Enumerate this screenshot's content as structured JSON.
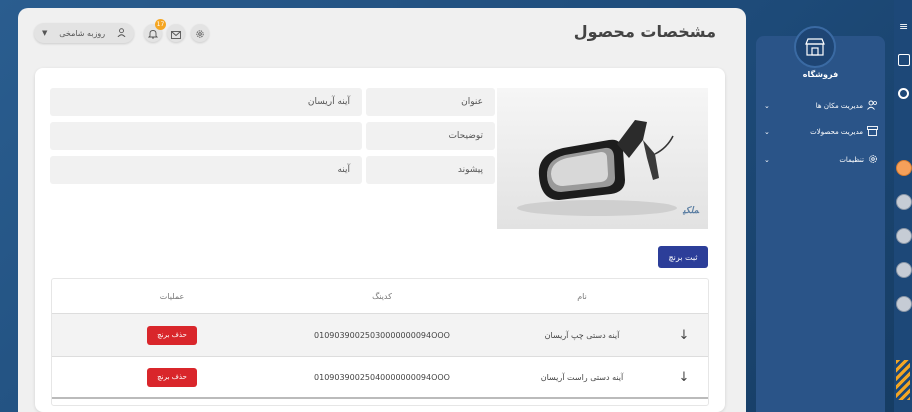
{
  "header": {
    "page_title": "مشخصات محصول",
    "user_name": "روزبه شامخی",
    "notification_count": "17"
  },
  "product": {
    "fields": [
      {
        "label": "عنوان",
        "value": "آینه آریسان"
      },
      {
        "label": "توضیحات",
        "value": ""
      },
      {
        "label": "پیشوند",
        "value": "آینه"
      }
    ],
    "photo_watermark": "ﻤﻠﻜﻴ"
  },
  "actions": {
    "add_brand_label": "ثبت برنچ"
  },
  "table": {
    "headers": {
      "name": "نام",
      "code": "کدینگ",
      "ops": "عملیات"
    },
    "rows": [
      {
        "name": "آینه دستی چپ آریسان",
        "code": "01090390025030000000094OOO",
        "delete_label": "حذف برنچ"
      },
      {
        "name": "آینه دستی راست آریسان",
        "code": "01090390025040000000094OOO",
        "delete_label": "حذف برنچ"
      }
    ]
  },
  "sidebar": {
    "title": "فروشگاه",
    "items": [
      {
        "label": "مدیریت مکان ها"
      },
      {
        "label": "مدیریت محصولات"
      },
      {
        "label": "تنظیمات"
      }
    ]
  },
  "colors": {
    "primary": "#2c3e99",
    "danger": "#d9262b",
    "sidebar": "#2a5488",
    "badge": "#f5a623"
  }
}
